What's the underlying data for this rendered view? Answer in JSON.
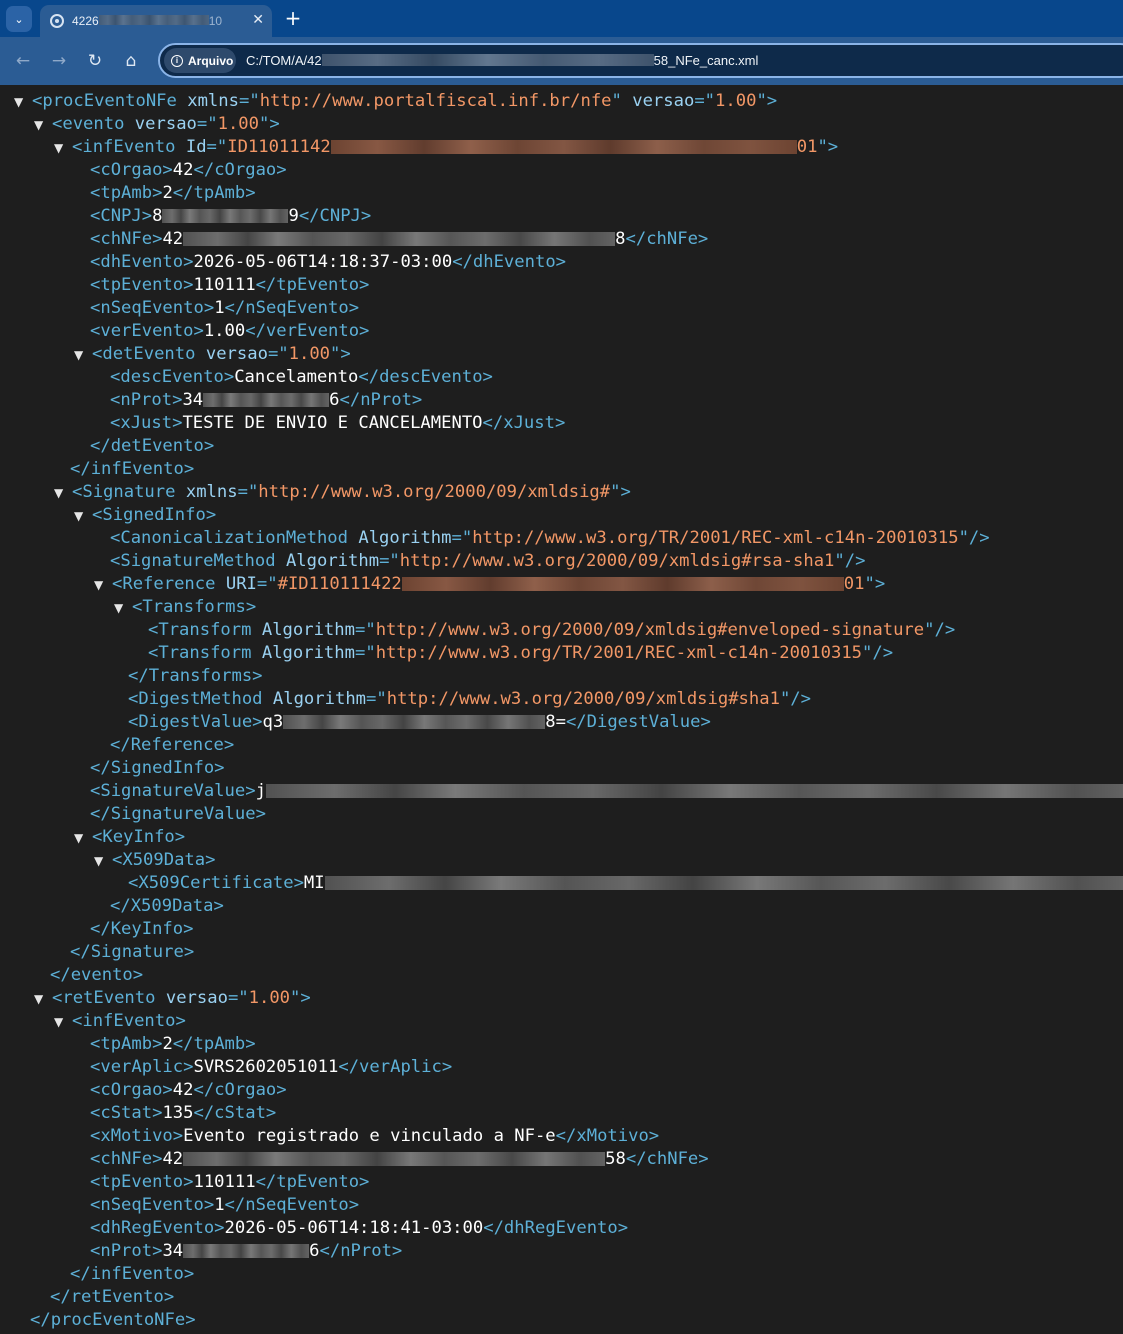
{
  "browser": {
    "tab_title": "4226",
    "tab_title_suffix": "10",
    "close_glyph": "✕",
    "new_tab_glyph": "+",
    "chip_label": "Arquivo",
    "url_prefix": "C:/TOM/A/42",
    "url_suffix": "58_NFe_canc.xml"
  },
  "xml": {
    "root_tag": "procEventoNFe",
    "root_xmlns": "http://www.portalfiscal.inf.br/nfe",
    "versao_value": "1.00",
    "evento": {
      "infEvento_id_prefix": "ID11011142",
      "infEvento_id_suffix": "01",
      "cOrgao": "42",
      "tpAmb": "2",
      "CNPJ_prefix": "8",
      "CNPJ_suffix": "9",
      "chNFe_prefix": "42",
      "chNFe_suffix": "8",
      "dhEvento": "2026-05-06T14:18:37-03:00",
      "tpEvento": "110111",
      "nSeqEvento": "1",
      "verEvento": "1.00",
      "descEvento": "Cancelamento",
      "nProt_prefix": "34",
      "nProt_suffix": "6",
      "xJust": "TESTE DE ENVIO E CANCELAMENTO"
    },
    "signature": {
      "xmlns": "http://www.w3.org/2000/09/xmldsig#",
      "canon_alg": "http://www.w3.org/TR/2001/REC-xml-c14n-20010315",
      "sig_alg": "http://www.w3.org/2000/09/xmldsig#rsa-sha1",
      "ref_uri_prefix": "#ID110111422",
      "ref_uri_suffix": "01",
      "transform1": "http://www.w3.org/2000/09/xmldsig#enveloped-signature",
      "transform2": "http://www.w3.org/TR/2001/REC-xml-c14n-20010315",
      "digest_alg": "http://www.w3.org/2000/09/xmldsig#sha1",
      "digest_prefix": "q3",
      "digest_suffix": "8=",
      "sigvalue_prefix": "j",
      "cert_prefix": "MI"
    },
    "retEvento": {
      "tpAmb": "2",
      "verAplic": "SVRS2602051011",
      "cOrgao": "42",
      "cStat": "135",
      "xMotivo": "Evento registrado e vinculado a NF-e",
      "chNFe_prefix": "42",
      "chNFe_suffix": "58",
      "tpEvento": "110111",
      "nSeqEvento": "1",
      "dhRegEvento": "2026-05-06T14:18:41-03:00",
      "nProt_prefix": "34",
      "nProt_suffix": "6"
    }
  },
  "colors": {
    "tag": "#5db0d7",
    "attr_name": "#9ad1f1",
    "attr_value": "#f29766",
    "text": "#ffffff",
    "background": "#1e1e1e",
    "titlebar": "#08478c",
    "toolbar": "#2b5c94"
  }
}
